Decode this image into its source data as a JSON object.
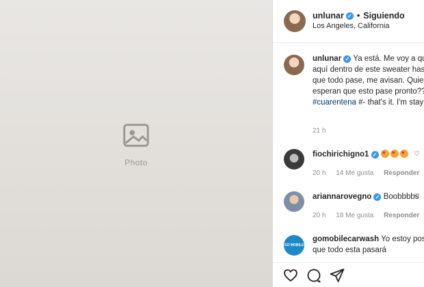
{
  "post": {
    "photo_placeholder": "Photo"
  },
  "header": {
    "username": "unlunar",
    "verified_mark": "✓",
    "separator": "•",
    "follow_status": "Siguiendo",
    "location": "Los Angeles, California"
  },
  "caption": {
    "username": "unlunar",
    "text": "Ya está. Me voy a quedar aquí dentro de este sweater hasta que todo pase, me avisan. Quienes esperan que esto pase pronto?? ",
    "hashtag": "#cuarentena",
    "text_en": " #- that's it. I'm staying inside of this sweater till this is over.",
    "time": "21 h"
  },
  "comments": [
    {
      "username": "fiochirichigno1",
      "text": "",
      "time": "20 h",
      "likes": "14 Me gusta",
      "reply": "Responder"
    },
    {
      "username": "ariannarovegno",
      "text": "Boobbbbs",
      "time": "20 h",
      "likes": "18 Me gusta",
      "reply": "Responder"
    },
    {
      "username": "gomobilecarwash",
      "text": "Yo estoy positivo que todo esta pasará",
      "avatar_text": "GO MOBILE"
    }
  ],
  "icons": {
    "like": "heart-outline-icon",
    "comment": "speech-bubble-icon",
    "share": "paper-plane-icon"
  },
  "colors": {
    "verified": "#3897f0",
    "link": "#00376b",
    "muted": "#8e8e8e"
  }
}
